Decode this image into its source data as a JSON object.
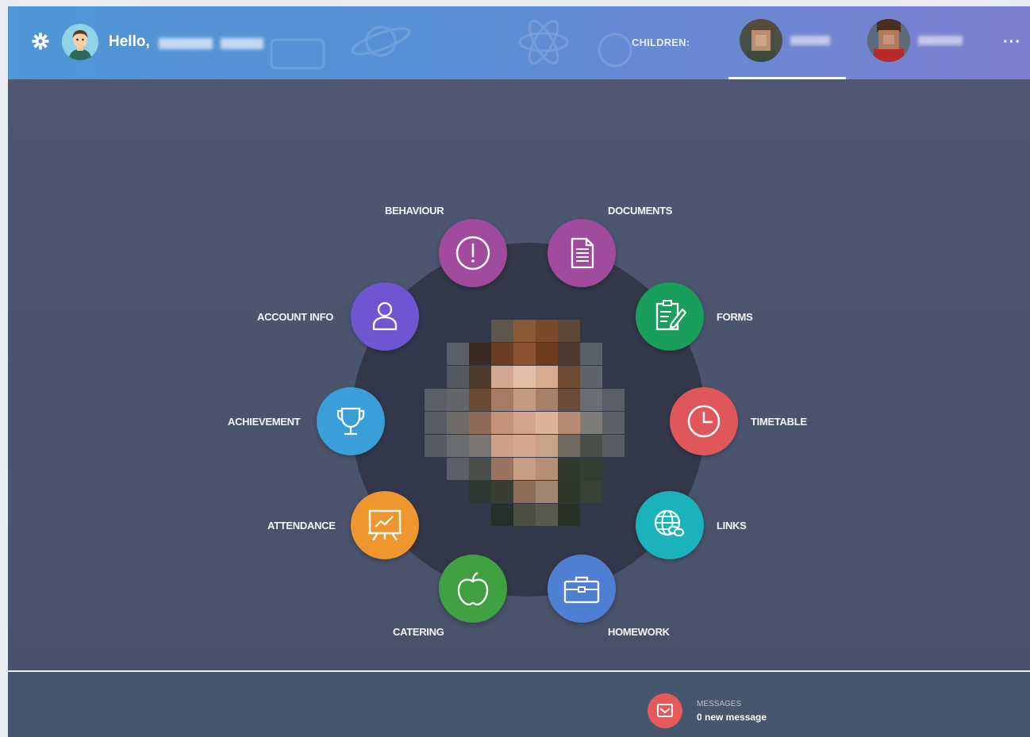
{
  "header": {
    "greeting": "Hello,",
    "children_label": "CHILDREN:",
    "more_label": "···",
    "icons": {
      "settings": "gear-icon",
      "more": "ellipsis-icon"
    }
  },
  "tiles": [
    {
      "id": "behaviour",
      "label": "BEHAVIOUR",
      "icon": "exclamation-circle-icon",
      "color": "#a04b9e"
    },
    {
      "id": "documents",
      "label": "DOCUMENTS",
      "icon": "document-icon",
      "color": "#a04b9e"
    },
    {
      "id": "forms",
      "label": "FORMS",
      "icon": "form-pen-icon",
      "color": "#1a9e5b"
    },
    {
      "id": "timetable",
      "label": "TIMETABLE",
      "icon": "clock-icon",
      "color": "#e0575a"
    },
    {
      "id": "links",
      "label": "LINKS",
      "icon": "globe-link-icon",
      "color": "#1ab3bb"
    },
    {
      "id": "homework",
      "label": "HOMEWORK",
      "icon": "briefcase-icon",
      "color": "#4f7fd2"
    },
    {
      "id": "catering",
      "label": "CATERING",
      "icon": "apple-icon",
      "color": "#3fa142"
    },
    {
      "id": "attendance",
      "label": "ATTENDANCE",
      "icon": "presentation-chart-icon",
      "color": "#f0962e"
    },
    {
      "id": "achievement",
      "label": "ACHIEVEMENT",
      "icon": "trophy-icon",
      "color": "#3a9ed8"
    },
    {
      "id": "account",
      "label": "ACCOUNT INFO",
      "icon": "user-icon",
      "color": "#6e56d3"
    }
  ],
  "messages": {
    "title": "MESSAGES",
    "count_text": "0 new message",
    "icon": "envelope-icon",
    "color": "#e45959"
  }
}
